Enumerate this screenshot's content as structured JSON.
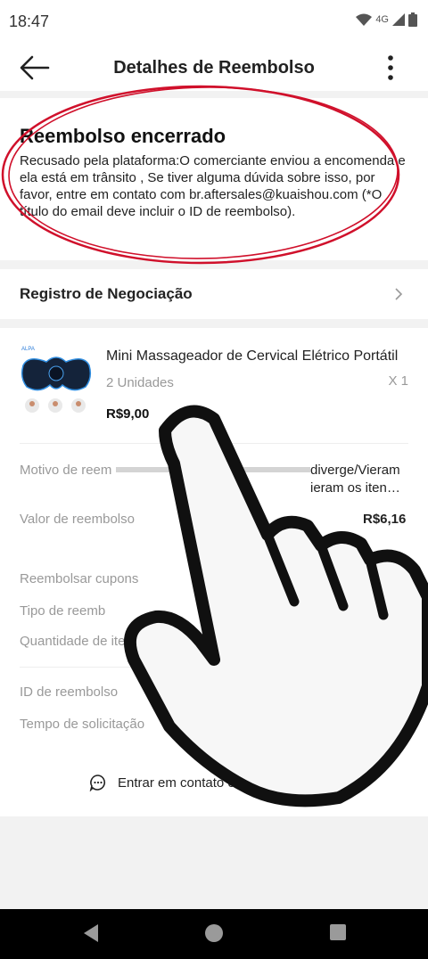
{
  "status_bar": {
    "time": "18:47",
    "network": "4G"
  },
  "header": {
    "title": "Detalhes de Reembolso"
  },
  "status_card": {
    "title": "Reembolso encerrado",
    "description": "Recusado pela plataforma:O comerciante enviou a encomenda e ela está em trânsito , Se tiver alguma dúvida sobre isso, por favor, entre em contato com br.aftersales@kuaishou.com (*O título do email deve incluir o ID de reembolso)."
  },
  "negotiation": {
    "label": "Registro de Negociação"
  },
  "product": {
    "brand": "ALPA",
    "name": "Mini Massageador de Cervical Elétrico Portátil",
    "units": "2 Unidades",
    "quantity": "X 1",
    "price": "R$9,00"
  },
  "details": {
    "reason_label": "Motivo de reem",
    "reason_value_1": "diverge/Vieram",
    "reason_value_2": "ieram os iten…",
    "amount_label": "Valor de reembolso",
    "amount_value": "R$6,16",
    "coupons_label": "Reembolsar cupons",
    "type_label": "Tipo de reemb",
    "quantity_label": "Quantidade de ite",
    "id_label": "ID de reembolso",
    "time_label": "Tempo de solicitação"
  },
  "contact": {
    "label": "Entrar em contato c"
  },
  "colors": {
    "annotation_red": "#d0102b",
    "background": "#f2f2f2",
    "nav_bar": "#000000"
  }
}
